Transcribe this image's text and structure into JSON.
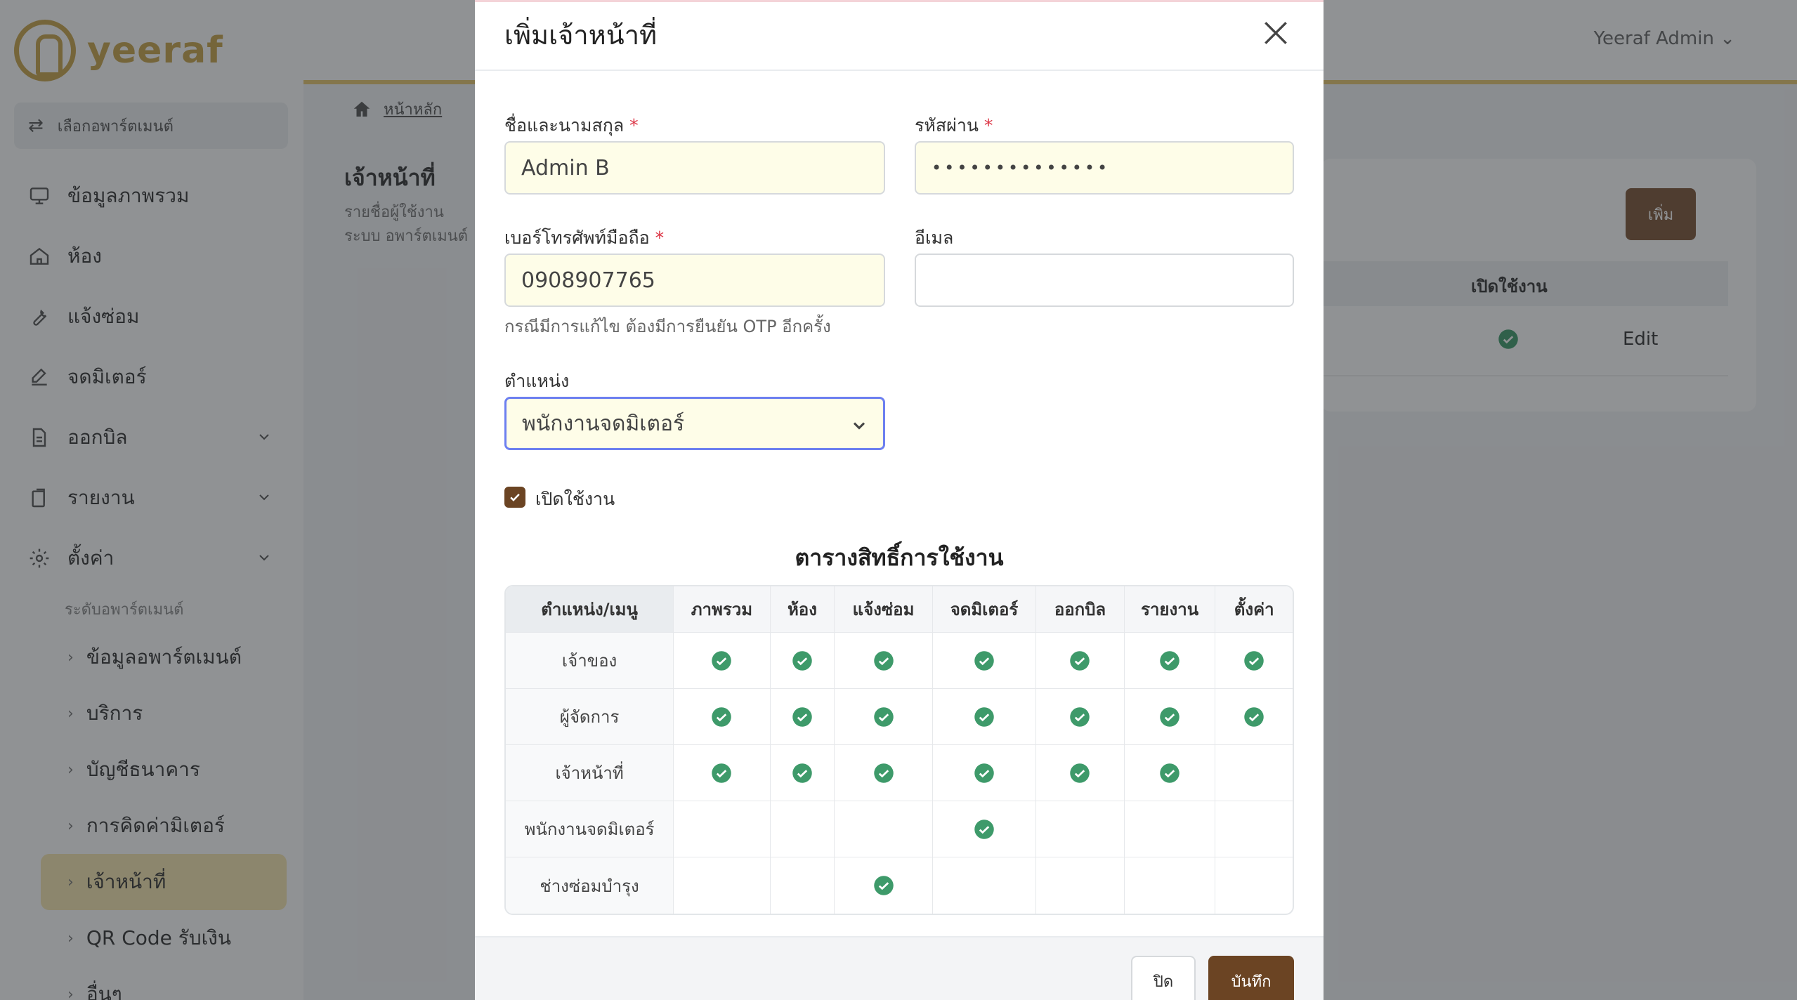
{
  "app": {
    "logo_text": "yeeraf",
    "apartment_select": "เลือกอพาร์ตเมนต์",
    "user_menu": "Yeeraf Admin"
  },
  "sidebar": {
    "items": [
      {
        "label": "ข้อมูลภาพรวม",
        "icon": "monitor-icon"
      },
      {
        "label": "ห้อง",
        "icon": "home-icon"
      },
      {
        "label": "แจ้งซ่อม",
        "icon": "wrench-icon"
      },
      {
        "label": "จดมิเตอร์",
        "icon": "edit-icon"
      },
      {
        "label": "ออกบิล",
        "icon": "document-icon"
      },
      {
        "label": "รายงาน",
        "icon": "clipboard-icon"
      },
      {
        "label": "ตั้งค่า",
        "icon": "gear-icon"
      }
    ],
    "section_label": "ระดับอพาร์ตเมนต์",
    "sub_items": [
      "ข้อมูลอพาร์ตเมนต์",
      "บริการ",
      "บัญชีธนาคาร",
      "การคิดค่ามิเตอร์",
      "เจ้าหน้าที่",
      "QR Code รับเงิน",
      "อื่นๆ"
    ],
    "active_sub_item": "เจ้าหน้าที่"
  },
  "page": {
    "breadcrumb_home": "หน้าหลัก",
    "title": "เจ้าหน้าที่",
    "description": "รายชื่อผู้ใช้งานระบบ อพาร์ตเมนต์ได้",
    "add_button": "เพิ่ม",
    "table_header_active": "เปิดใช้งาน",
    "table_edit_link": "Edit"
  },
  "modal": {
    "title": "เพิ่มเจ้าหน้าที่",
    "name_label": "ชื่อและนามสกุล",
    "name_value": "Admin B",
    "password_label": "รหัสผ่าน",
    "password_value": "••••••••••••••",
    "phone_label": "เบอร์โทรศัพท์มือถือ",
    "phone_value": "0908907765",
    "phone_hint": "กรณีมีการแก้ไข ต้องมีการยืนยัน OTP อีกครั้ง",
    "email_label": "อีเมล",
    "email_value": "",
    "position_label": "ตำแหน่ง",
    "position_value": "พนักงานจดมิเตอร์",
    "active_label": "เปิดใช้งาน",
    "required_mark": "*",
    "perm_title": "ตารางสิทธิ์การใช้งาน",
    "perm_columns": [
      "ตำแหน่ง/เมนู",
      "ภาพรวม",
      "ห้อง",
      "แจ้งซ่อม",
      "จดมิเตอร์",
      "ออกบิล",
      "รายงาน",
      "ตั้งค่า"
    ],
    "perm_rows": [
      {
        "role": "เจ้าของ",
        "perms": [
          true,
          true,
          true,
          true,
          true,
          true,
          true
        ]
      },
      {
        "role": "ผู้จัดการ",
        "perms": [
          true,
          true,
          true,
          true,
          true,
          true,
          true
        ]
      },
      {
        "role": "เจ้าหน้าที่",
        "perms": [
          true,
          true,
          true,
          true,
          true,
          true,
          false
        ]
      },
      {
        "role": "พนักงานจดมิเตอร์",
        "perms": [
          false,
          false,
          false,
          true,
          false,
          false,
          false
        ]
      },
      {
        "role": "ช่างซ่อมบำรุง",
        "perms": [
          false,
          false,
          true,
          false,
          false,
          false,
          false
        ]
      }
    ],
    "close_button": "ปิด",
    "save_button": "บันทึก"
  },
  "colors": {
    "brand_gold": "#c9a44a",
    "primary_brown": "#6b4423",
    "check_green": "#3e9a6a",
    "required_red": "#dc3545",
    "input_fill": "#fefde8"
  }
}
